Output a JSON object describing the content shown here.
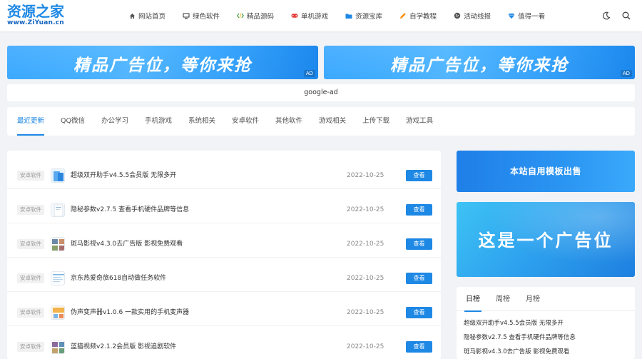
{
  "header": {
    "logo_main": "资源之家",
    "logo_sub": "www.ZiYuan.cn",
    "nav": [
      {
        "label": "网站首页",
        "icon": "home-icon",
        "color": "#555555"
      },
      {
        "label": "绿色软件",
        "icon": "monitor-icon",
        "color": "#333333"
      },
      {
        "label": "精品源码",
        "icon": "code-icon",
        "color": "#43a047"
      },
      {
        "label": "单机游戏",
        "icon": "gamepad-icon",
        "color": "#e53935"
      },
      {
        "label": "资源宝库",
        "icon": "folder-icon",
        "color": "#1e88e5"
      },
      {
        "label": "自学教程",
        "icon": "pencil-icon",
        "color": "#fb8c00"
      },
      {
        "label": "活动线报",
        "icon": "globe-icon",
        "color": "#555555"
      },
      {
        "label": "值得一看",
        "icon": "diamond-icon",
        "color": "#1e88e5"
      }
    ]
  },
  "ads": {
    "banner_text": "精品广告位，等你来抢",
    "ad_tag": "AD",
    "google_ad": "google-ad"
  },
  "tabs": [
    "最近更新",
    "QQ微信",
    "办公学习",
    "手机游戏",
    "系统相关",
    "安卓软件",
    "其他软件",
    "游戏相关",
    "上传下载",
    "游戏工具"
  ],
  "list": [
    {
      "category": "安卓软件",
      "title": "超级双开助手v4.5.5会员版 无限多开",
      "date": "2022-10-25",
      "button": "查看",
      "thumb": "blue"
    },
    {
      "category": "安卓软件",
      "title": "隐秘参数v2.7.5 查看手机硬件品牌等信息",
      "date": "2022-10-25",
      "button": "查看",
      "thumb": "light"
    },
    {
      "category": "安卓软件",
      "title": "斑马影视v4.3.0去广告版 影视免费观看",
      "date": "2022-10-25",
      "button": "查看",
      "thumb": "photo"
    },
    {
      "category": "安卓软件",
      "title": "京东热爱奇旅618自动做任务软件",
      "date": "2022-10-25",
      "button": "查看",
      "thumb": "doc"
    },
    {
      "category": "安卓软件",
      "title": "伪声变声器v1.0.6 一款实用的手机变声器",
      "date": "2022-10-25",
      "button": "查看",
      "thumb": "orange"
    },
    {
      "category": "安卓软件",
      "title": "蓝猫视频v2.1.2会员版 影视追剧软件",
      "date": "2022-10-25",
      "button": "查看",
      "thumb": "photo"
    }
  ],
  "sidebar": {
    "template_sale": "本站自用模板出售",
    "ad_text": "这是一个广告位",
    "rank_tabs": [
      "日榜",
      "周榜",
      "月榜"
    ],
    "rank_items": [
      "超级双开助手v4.5.5会员版 无限多开",
      "隐秘参数v2.7.5 查看手机硬件品牌等信息",
      "斑马影视v4.3.0去广告版 影视免费观看"
    ]
  },
  "colors": {
    "accent": "#1e88e5",
    "background": "#f1f3f6"
  }
}
